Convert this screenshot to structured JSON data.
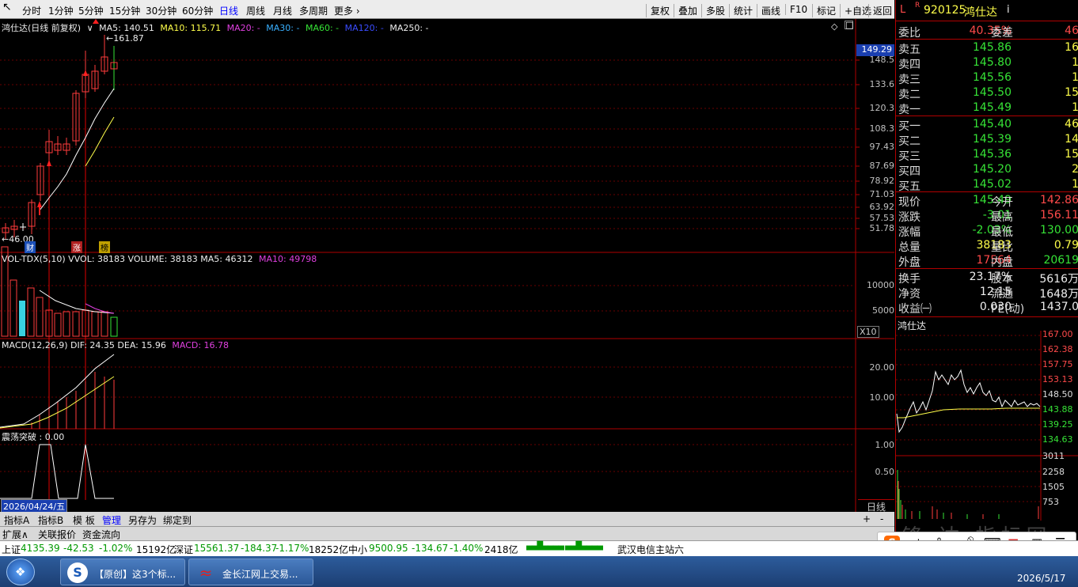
{
  "toolbar": {
    "periods": [
      "分时",
      "1分钟",
      "5分钟",
      "15分钟",
      "30分钟",
      "60分钟",
      "日线",
      "周线",
      "月线",
      "多周期",
      "更多"
    ],
    "active": "日线",
    "tools": [
      "复权",
      "叠加",
      "多股",
      "统计",
      "画线",
      "F10",
      "标记",
      "+自选",
      "返回"
    ]
  },
  "chart_header": {
    "title": "鸿仕达(日线 前复权)",
    "ma5": "MA5: 140.51",
    "ma10": "MA10: 115.71",
    "ma20": "MA20: -",
    "ma30": "MA30: -",
    "ma60": "MA60: -",
    "ma120": "MA120: -",
    "ma250": "MA250: -",
    "high_label": "161.87",
    "low_label": "46.00",
    "price_tag": "149.29",
    "price_axis": [
      "148.5",
      "133.6",
      "120.3",
      "108.3",
      "97.43",
      "87.69",
      "78.92",
      "71.03",
      "63.92",
      "57.53",
      "51.78"
    ],
    "markers": [
      "财",
      "涨",
      "榜"
    ]
  },
  "volume": {
    "header": "VOL-TDX(5,10)  VVOL: 38183  VOLUME: 38183  MA5: 46312",
    "ma10": "MA10: 49798",
    "axis": [
      "10000",
      "5000"
    ],
    "unit": "X10"
  },
  "macd": {
    "header": "MACD(12,26,9)  DIF: 24.35  DEA: 15.96",
    "macd": "MACD: 16.78",
    "axis": [
      "20.00",
      "10.00"
    ]
  },
  "osc": {
    "header": "震荡突破  : 0.00",
    "axis": [
      "1.00",
      "0.50"
    ],
    "date": "2026/04/24/五",
    "period": "日线"
  },
  "quote": {
    "code": "920125",
    "name": "鸿仕达",
    "weibi_label": "委比",
    "weibi": "40.35%",
    "weicha_label": "委差",
    "weicha": "46",
    "asks": [
      {
        "label": "卖五",
        "price": "145.86",
        "vol": "16"
      },
      {
        "label": "卖四",
        "price": "145.80",
        "vol": "1"
      },
      {
        "label": "卖三",
        "price": "145.56",
        "vol": "1"
      },
      {
        "label": "卖二",
        "price": "145.50",
        "vol": "15"
      },
      {
        "label": "卖一",
        "price": "145.49",
        "vol": "1"
      }
    ],
    "bids": [
      {
        "label": "买一",
        "price": "145.40",
        "vol": "46"
      },
      {
        "label": "买二",
        "price": "145.39",
        "vol": "14"
      },
      {
        "label": "买三",
        "price": "145.36",
        "vol": "15"
      },
      {
        "label": "买四",
        "price": "145.20",
        "vol": "2"
      },
      {
        "label": "买五",
        "price": "145.02",
        "vol": "1"
      }
    ],
    "stats": [
      {
        "l": "现价",
        "v": "145.49",
        "l2": "今开",
        "v2": "142.86",
        "c": "grn",
        "c2": "red"
      },
      {
        "l": "涨跌",
        "v": "-3.01",
        "l2": "最高",
        "v2": "156.11",
        "c": "grn",
        "c2": "red"
      },
      {
        "l": "涨幅",
        "v": "-2.03%",
        "l2": "最低",
        "v2": "130.00",
        "c": "grn",
        "c2": "grn"
      },
      {
        "l": "总量",
        "v": "38183",
        "l2": "量比",
        "v2": "0.79",
        "c": "yel",
        "c2": "yel"
      },
      {
        "l": "外盘",
        "v": "17564",
        "l2": "内盘",
        "v2": "20619",
        "c": "red",
        "c2": "grn"
      }
    ],
    "finance": [
      {
        "l": "换手",
        "v": "23.17%",
        "l2": "股本",
        "v2": "5616万"
      },
      {
        "l": "净资",
        "v": "12.15",
        "l2": "流通",
        "v2": "1648万"
      },
      {
        "l": "收益㈠",
        "v": "0.030",
        "l2": "PE(动)",
        "v2": "1437.0"
      }
    ],
    "mini_name": "鸿仕达",
    "mini_axis": [
      "167.00",
      "162.38",
      "157.75",
      "153.13",
      "148.50",
      "143.88",
      "139.25",
      "134.63"
    ],
    "mini_vol_axis": [
      "3011",
      "2258",
      "1505",
      "753"
    ]
  },
  "bottom_tabs": [
    "指标A",
    "指标B",
    "模 板",
    "管理",
    "另存为",
    "绑定到"
  ],
  "bottom_tabs2": [
    "扩展∧",
    "关联报价",
    "资金流向"
  ],
  "status": {
    "sh_label": "上证",
    "sh": "4135.39",
    "sh_chg": "-42.53",
    "sh_pct": "-1.02%",
    "sh_amt": "15192亿",
    "sz_label": "深证",
    "sz": "15561.37",
    "sz_chg": "-184.37",
    "sz_pct": "-1.17%",
    "sz_amt": "18252亿",
    "zx_label": "中小",
    "zx": "9500.95",
    "zx_chg": "-134.67",
    "zx_pct": "-1.40%",
    "zx_amt": "2418亿",
    "server": "武汉电信主站六"
  },
  "taskbar": {
    "btn1": "【原创】这3个标...",
    "btn2": "金长江网上交易...",
    "time": "2026/5/17",
    "ime": [
      "中",
      "°,"
    ],
    "watermark": "锋 达 指标网"
  },
  "colors": {
    "up": "#ff3c3c",
    "down": "#36e336",
    "ma5": "#ffffff",
    "ma10": "#ffff4a"
  }
}
